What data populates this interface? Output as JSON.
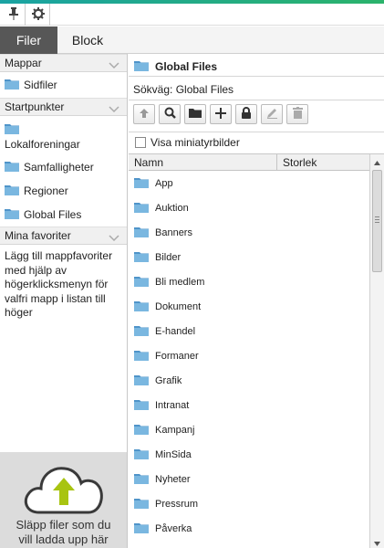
{
  "topbar": {
    "icons": [
      "pin-icon",
      "gear-icon"
    ]
  },
  "tabs": {
    "active": "Filer",
    "inactive": "Block"
  },
  "left": {
    "folders_head": "Mappar",
    "sidfiler": "Sidfiler",
    "start_head": "Startpunkter",
    "start_items": [
      "Lokalforeningar",
      "Samfalligheter",
      "Regioner",
      "Global Files"
    ],
    "fav_head": "Mina favoriter",
    "fav_text": "Lägg till mappfavoriter med hjälp av högerklicksmenyn för valfri mapp i listan till höger",
    "drop_text_1": "Släpp filer som du",
    "drop_text_2": "vill ladda upp här"
  },
  "right": {
    "title": "Global Files",
    "path": "Sökväg: Global Files",
    "thumb_label": "Visa miniatyrbilder",
    "col_name": "Namn",
    "col_size": "Storlek",
    "rows": [
      "App",
      "Auktion",
      "Banners",
      "Bilder",
      "Bli medlem",
      "Dokument",
      "E-handel",
      "Formaner",
      "Grafik",
      "Intranat",
      "Kampanj",
      "MinSida",
      "Nyheter",
      "Pressrum",
      "Påverka"
    ]
  },
  "colors": {
    "folder": "#7ab7e0",
    "folder_dark": "#4f94c9",
    "tab_active": "#575757",
    "upload_arrow": "#a8c411"
  }
}
